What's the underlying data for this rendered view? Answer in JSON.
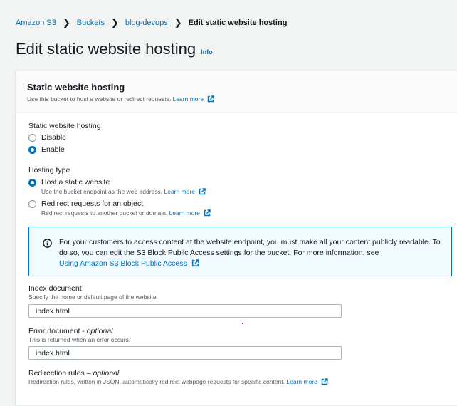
{
  "breadcrumb": {
    "items": [
      "Amazon S3",
      "Buckets",
      "blog-devops"
    ],
    "current": "Edit static website hosting"
  },
  "page": {
    "title": "Edit static website hosting",
    "info_label": "Info"
  },
  "panel": {
    "title": "Static website hosting",
    "description": "Use this bucket to host a website or redirect requests.",
    "learn_more": "Learn more"
  },
  "hosting_toggle": {
    "label": "Static website hosting",
    "options": [
      "Disable",
      "Enable"
    ],
    "selected": "Enable"
  },
  "hosting_type": {
    "label": "Hosting type",
    "options": [
      {
        "label": "Host a static website",
        "description": "Use the bucket endpoint as the web address.",
        "link": "Learn more"
      },
      {
        "label": "Redirect requests for an object",
        "description": "Redirect requests to another bucket or domain.",
        "link": "Learn more"
      }
    ],
    "selected": "Host a static website"
  },
  "alert": {
    "text": "For your customers to access content at the website endpoint, you must make all your content publicly readable. To do so, you can edit the S3 Block Public Access settings for the bucket. For more information, see",
    "link": "Using Amazon S3 Block Public Access"
  },
  "index_document": {
    "label": "Index document",
    "description": "Specify the home or default page of the website.",
    "value": "index.html"
  },
  "error_document": {
    "label": "Error document",
    "optional": "optional",
    "description": "This is returned when an error occurs.",
    "value": "index.html"
  },
  "redirection_rules": {
    "label": "Redirection rules –",
    "optional": "optional",
    "description": "Redirection rules, written in JSON, automatically redirect webpage requests for specific content.",
    "link": "Learn more"
  },
  "colors": {
    "link": "#0073bb",
    "alert_bg": "#f1faff",
    "alert_border": "#0073bb"
  }
}
